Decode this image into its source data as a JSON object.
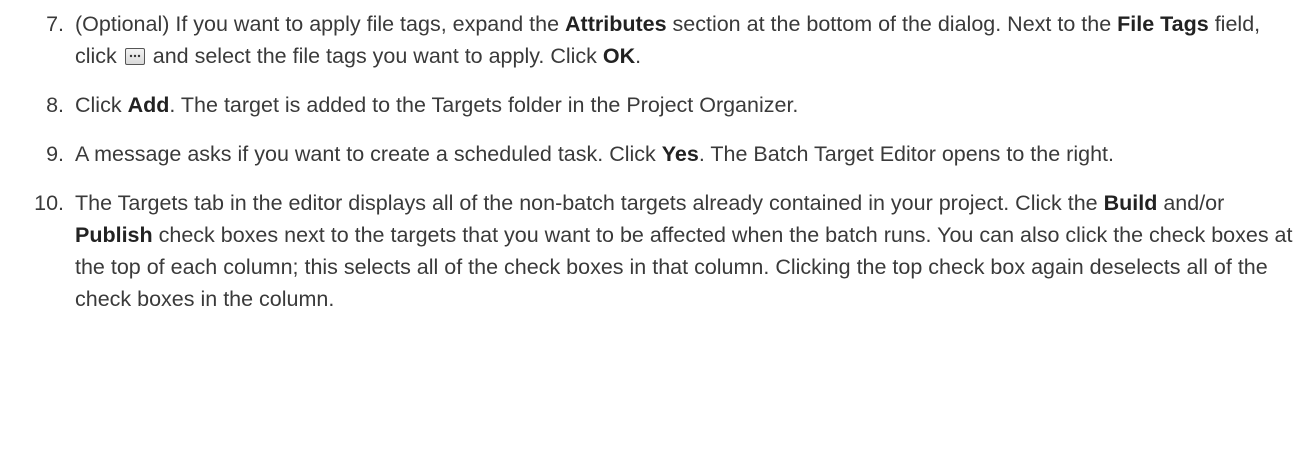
{
  "steps": [
    {
      "number": "7.",
      "t1": "(Optional) If you want to apply file tags, expand the ",
      "b1": "Attributes",
      "t2": " section at the bottom of the dialog. Next to the ",
      "b2": "File Tags",
      "t3": " field, click ",
      "icon": "browse-ellipsis-button-icon",
      "t4": " and select the file tags you want to apply. Click ",
      "b3": "OK",
      "t5": "."
    },
    {
      "number": "8.",
      "t1": "Click ",
      "b1": "Add",
      "t2": ". The target is added to the Targets folder in the Project Organizer."
    },
    {
      "number": "9.",
      "t1": "A message asks if you want to create a scheduled task. Click ",
      "b1": "Yes",
      "t2": ". The Batch Target Editor opens to the right."
    },
    {
      "number": "10.",
      "t1": "The Targets tab in the editor displays all of the non-batch targets already contained in your project. Click the ",
      "b1": "Build",
      "t2": " and/or ",
      "b2": "Publish",
      "t3": " check boxes next to the targets that you want to be affected when the batch runs. You can also click the check boxes at the top of each column; this selects all of the check boxes in that column. Clicking the top check box again deselects all of the check boxes in the column."
    }
  ]
}
